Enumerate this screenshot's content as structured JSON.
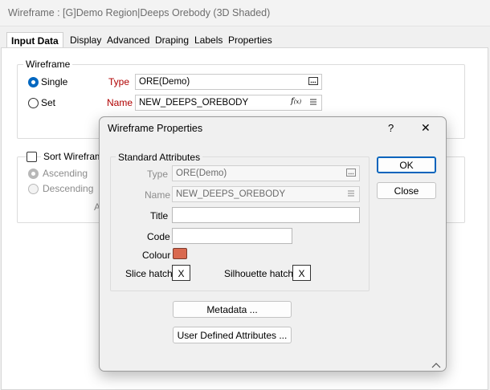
{
  "window": {
    "title": "Wireframe : [G]Demo Region|Deeps Orebody (3D Shaded)"
  },
  "tabs": [
    "Input Data",
    "Display",
    "Advanced",
    "Draping",
    "Labels",
    "Properties"
  ],
  "wireframe_group": {
    "legend": "Wireframe",
    "single_label": "Single",
    "set_label": "Set",
    "type_label": "Type",
    "type_value": "ORE(Demo)",
    "name_label": "Name",
    "name_value": "NEW_DEEPS_OREBODY"
  },
  "sort_group": {
    "checkbox_label": "Sort Wirefram",
    "ascending_label": "Ascending",
    "descending_label": "Descending",
    "partial_text": "A"
  },
  "icons": {
    "browse": "ellipsis-icon",
    "function": "function-icon",
    "list": "list-icon",
    "help": "question-icon",
    "close": "close-icon",
    "resize": "chevron-up-icon"
  },
  "dialog": {
    "title": "Wireframe Properties",
    "help_glyph": "?",
    "close_glyph": "✕",
    "standard_attributes": {
      "legend": "Standard Attributes",
      "type_label": "Type",
      "type_value": "ORE(Demo)",
      "name_label": "Name",
      "name_value": "NEW_DEEPS_OREBODY",
      "title_label": "Title",
      "title_value": "",
      "code_label": "Code",
      "code_value": "",
      "colour_label": "Colour",
      "colour_value": "#d9694f",
      "slice_hatch_label": "Slice hatch",
      "slice_hatch_value": "X",
      "silhouette_hatch_label": "Silhouette hatch",
      "silhouette_hatch_value": "X"
    },
    "ok_label": "OK",
    "close_label": "Close",
    "metadata_label": "Metadata ...",
    "uda_label": "User Defined Attributes ..."
  },
  "colors": {
    "accent": "#0067c0",
    "required_label": "#b00000"
  }
}
